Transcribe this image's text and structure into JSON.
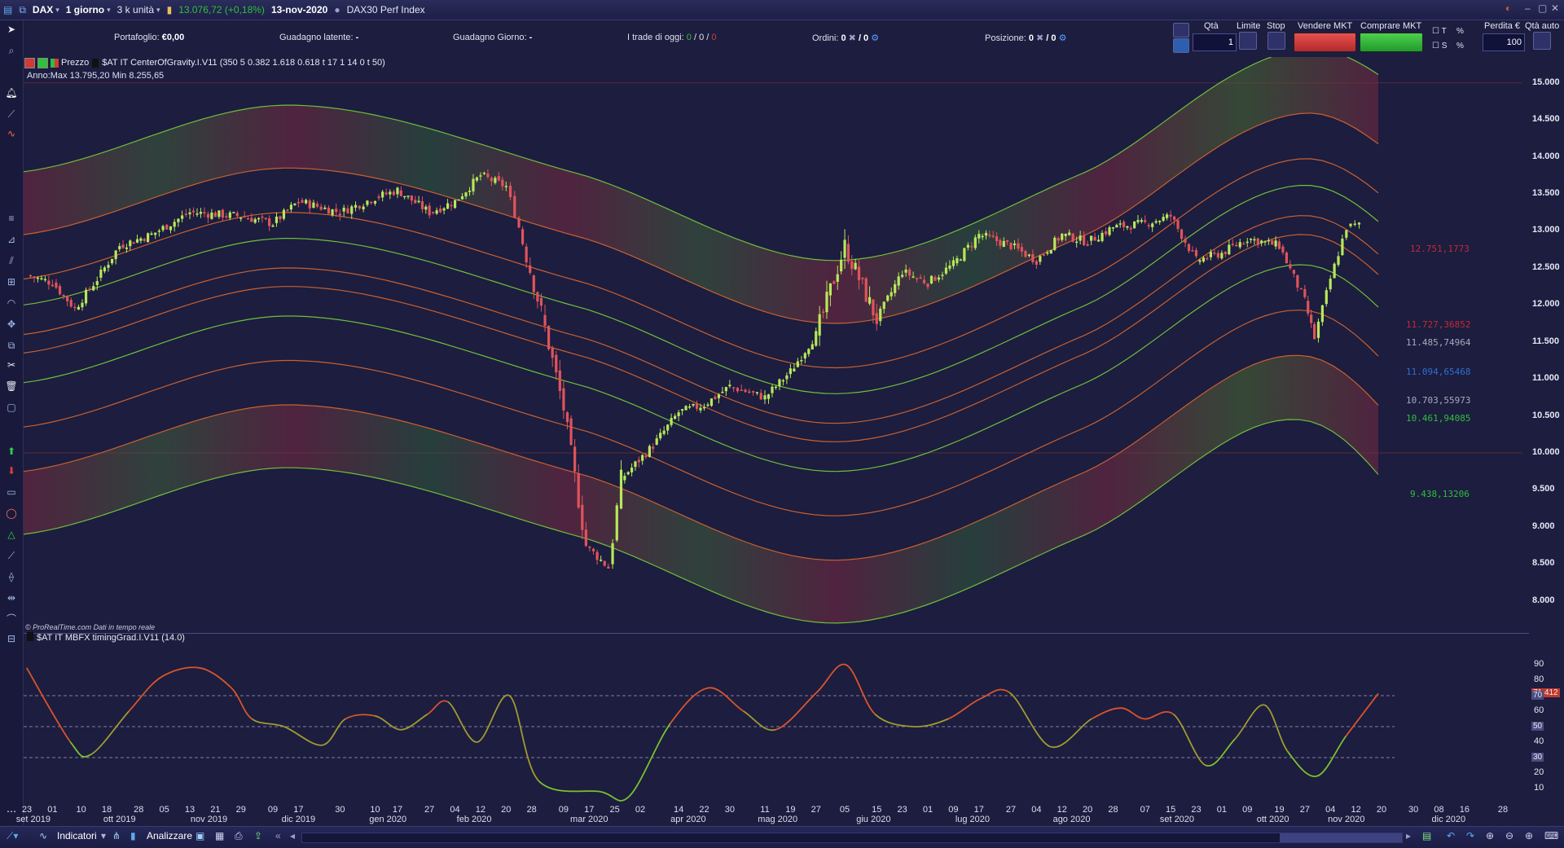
{
  "topbar": {
    "symbol": "DAX",
    "timeframe": "1 giorno",
    "units": "3 k unità",
    "last_price": "13.076,72 (+0,18%)",
    "date": "13-nov-2020",
    "instrument_name": "DAX30 Perf Index"
  },
  "portfolio": {
    "portafoglio_label": "Portafoglio:",
    "portafoglio_value": "€0,00",
    "guadagno_latente_label": "Guadagno latente:",
    "guadagno_latente_value": "-",
    "guadagno_giorno_label": "Guadagno Giorno:",
    "guadagno_giorno_value": "-",
    "trade_oggi_label": "I trade di oggi:",
    "trade_oggi_value1": "0",
    "trade_oggi_sep": "/ 0 /",
    "trade_oggi_value3": "0",
    "ordini_label": "Ordini:",
    "ordini_value": "0",
    "ordini_value2": "/ 0",
    "posizione_label": "Posizione:",
    "posizione_value": "0",
    "posizione_value2": "/ 0"
  },
  "order_panel": {
    "qta_label": "Qtà",
    "qta_value": "1",
    "limite_label": "Limite",
    "stop_label": "Stop",
    "vendere_label": "Vendere MKT",
    "comprare_label": "Comprare MKT",
    "t_label": "T",
    "s_label": "S",
    "pct_t": "%",
    "pct_s": "%",
    "perdita_label": "Perdita €",
    "perdita_value": "100",
    "qta_auto_label": "Qtà auto"
  },
  "legend": {
    "prezzo_label": "Prezzo",
    "indicator_label": "$AT IT CenterOfGravity.I.V11 (350 5 0.382 1.618 0.618 t 17 1 14 0 t 50)",
    "anno_text": "Anno:Max 13.795,20 Min 8.255,65",
    "osc_label": "$AT IT MBFX timingGrad.I.V11 (14.0)",
    "copyright": "© ProRealTime.com  Dati in tempo reale"
  },
  "price_scale": [
    "15.000",
    "14.500",
    "14.000",
    "13.500",
    "13.000",
    "12.500",
    "12.000",
    "11.500",
    "11.000",
    "10.500",
    "10.000",
    "9.500",
    "9.000",
    "8.500",
    "8.000"
  ],
  "osc_scale": [
    "90",
    "80",
    "70",
    "60",
    "50",
    "40",
    "30",
    "20",
    "10"
  ],
  "osc_markers": [
    "71,412",
    "70",
    "50",
    "30"
  ],
  "levels": [
    {
      "text": "12.751,1773",
      "color": "#c42a34"
    },
    {
      "text": "11.727,36852",
      "color": "#c42a34"
    },
    {
      "text": "11.485,74964",
      "color": "#a8aabb"
    },
    {
      "text": "11.094,65468",
      "color": "#2f6fd0"
    },
    {
      "text": "10.703,55973",
      "color": "#a8aabb"
    },
    {
      "text": "10.461,94085",
      "color": "#2fbf3a"
    },
    {
      "text": "9.438,13206",
      "color": "#2fbf3a"
    }
  ],
  "date_axis": {
    "days": [
      "23",
      "01",
      "10",
      "18",
      "28",
      "05",
      "13",
      "21",
      "29",
      "09",
      "17",
      "30",
      "10",
      "17",
      "27",
      "04",
      "12",
      "20",
      "28",
      "09",
      "17",
      "25",
      "02",
      "14",
      "22",
      "30",
      "11",
      "19",
      "27",
      "05",
      "15",
      "23",
      "01",
      "09",
      "17",
      "27",
      "04",
      "12",
      "20",
      "28",
      "07",
      "15",
      "23",
      "01",
      "09",
      "19",
      "27",
      "04",
      "12",
      "20",
      "30",
      "08",
      "16",
      "28"
    ],
    "months": [
      "set 2019",
      "ott 2019",
      "nov 2019",
      "dic 2019",
      "gen 2020",
      "feb 2020",
      "mar 2020",
      "apr 2020",
      "mag 2020",
      "giu 2020",
      "lug 2020",
      "ago 2020",
      "set 2020",
      "ott 2020",
      "nov 2020",
      "dic 2020"
    ]
  },
  "bottombar": {
    "indicatori_label": "Indicatori",
    "analizzare_label": "Analizzare"
  },
  "chart_data": {
    "type": "candlestick",
    "title": "DAX30 Perf Index",
    "timeframe": "1 giorno",
    "x_range": [
      "2019-09-23",
      "2020-12-28"
    ],
    "ylim": [
      7600,
      15350
    ],
    "close_series": [
      {
        "date": "2019-09-23",
        "value": 12400
      },
      {
        "date": "2019-10-01",
        "value": 12300
      },
      {
        "date": "2019-10-08",
        "value": 11950
      },
      {
        "date": "2019-10-15",
        "value": 12350
      },
      {
        "date": "2019-10-22",
        "value": 12800
      },
      {
        "date": "2019-11-01",
        "value": 12950
      },
      {
        "date": "2019-11-13",
        "value": 13250
      },
      {
        "date": "2019-11-29",
        "value": 13200
      },
      {
        "date": "2019-12-09",
        "value": 13100
      },
      {
        "date": "2019-12-17",
        "value": 13400
      },
      {
        "date": "2019-12-30",
        "value": 13250
      },
      {
        "date": "2020-01-10",
        "value": 13450
      },
      {
        "date": "2020-01-17",
        "value": 13550
      },
      {
        "date": "2020-01-27",
        "value": 13250
      },
      {
        "date": "2020-02-04",
        "value": 13400
      },
      {
        "date": "2020-02-12",
        "value": 13750
      },
      {
        "date": "2020-02-20",
        "value": 13600
      },
      {
        "date": "2020-02-24",
        "value": 13050
      },
      {
        "date": "2020-03-02",
        "value": 11900
      },
      {
        "date": "2020-03-09",
        "value": 10600
      },
      {
        "date": "2020-03-16",
        "value": 8750
      },
      {
        "date": "2020-03-23",
        "value": 8450
      },
      {
        "date": "2020-03-27",
        "value": 9650
      },
      {
        "date": "2020-04-06",
        "value": 10100
      },
      {
        "date": "2020-04-14",
        "value": 10550
      },
      {
        "date": "2020-04-22",
        "value": 10650
      },
      {
        "date": "2020-04-30",
        "value": 10900
      },
      {
        "date": "2020-05-11",
        "value": 10750
      },
      {
        "date": "2020-05-19",
        "value": 11100
      },
      {
        "date": "2020-05-27",
        "value": 11600
      },
      {
        "date": "2020-06-05",
        "value": 12800
      },
      {
        "date": "2020-06-15",
        "value": 11800
      },
      {
        "date": "2020-06-23",
        "value": 12450
      },
      {
        "date": "2020-07-01",
        "value": 12300
      },
      {
        "date": "2020-07-09",
        "value": 12550
      },
      {
        "date": "2020-07-17",
        "value": 12950
      },
      {
        "date": "2020-07-27",
        "value": 12800
      },
      {
        "date": "2020-08-04",
        "value": 12600
      },
      {
        "date": "2020-08-12",
        "value": 12950
      },
      {
        "date": "2020-08-20",
        "value": 12850
      },
      {
        "date": "2020-08-28",
        "value": 13050
      },
      {
        "date": "2020-09-07",
        "value": 13100
      },
      {
        "date": "2020-09-15",
        "value": 13200
      },
      {
        "date": "2020-09-23",
        "value": 12600
      },
      {
        "date": "2020-10-01",
        "value": 12700
      },
      {
        "date": "2020-10-09",
        "value": 12900
      },
      {
        "date": "2020-10-19",
        "value": 12800
      },
      {
        "date": "2020-10-27",
        "value": 12050
      },
      {
        "date": "2020-10-30",
        "value": 11550
      },
      {
        "date": "2020-11-04",
        "value": 12350
      },
      {
        "date": "2020-11-09",
        "value": 13050
      },
      {
        "date": "2020-11-13",
        "value": 13076.72
      }
    ],
    "annual_max": 13795.2,
    "annual_min": 8255.65,
    "levels": [
      12751.1773,
      11727.36852,
      11485.74964,
      11094.65468,
      10703.55973,
      10461.94085,
      9438.13206
    ],
    "oscillator": {
      "name": "$AT IT MBFX timingGrad.I.V11 (14.0)",
      "ylim": [
        0,
        100
      ],
      "reference_lines": [
        70,
        50,
        30
      ],
      "last_value": 71.412,
      "series": [
        {
          "date": "2019-09-23",
          "value": 88
        },
        {
          "date": "2019-10-08",
          "value": 40
        },
        {
          "date": "2019-10-15",
          "value": 32
        },
        {
          "date": "2019-10-28",
          "value": 60
        },
        {
          "date": "2019-11-08",
          "value": 82
        },
        {
          "date": "2019-11-21",
          "value": 88
        },
        {
          "date": "2019-12-02",
          "value": 75
        },
        {
          "date": "2019-12-09",
          "value": 55
        },
        {
          "date": "2019-12-20",
          "value": 50
        },
        {
          "date": "2020-01-02",
          "value": 38
        },
        {
          "date": "2020-01-10",
          "value": 55
        },
        {
          "date": "2020-01-20",
          "value": 57
        },
        {
          "date": "2020-01-29",
          "value": 48
        },
        {
          "date": "2020-02-07",
          "value": 58
        },
        {
          "date": "2020-02-14",
          "value": 66
        },
        {
          "date": "2020-02-24",
          "value": 40
        },
        {
          "date": "2020-03-06",
          "value": 70
        },
        {
          "date": "2020-03-16",
          "value": 15
        },
        {
          "date": "2020-04-06",
          "value": 8
        },
        {
          "date": "2020-04-16",
          "value": 5
        },
        {
          "date": "2020-04-30",
          "value": 52
        },
        {
          "date": "2020-05-13",
          "value": 75
        },
        {
          "date": "2020-05-25",
          "value": 60
        },
        {
          "date": "2020-06-05",
          "value": 48
        },
        {
          "date": "2020-06-19",
          "value": 72
        },
        {
          "date": "2020-06-29",
          "value": 90
        },
        {
          "date": "2020-07-09",
          "value": 58
        },
        {
          "date": "2020-07-22",
          "value": 50
        },
        {
          "date": "2020-08-03",
          "value": 55
        },
        {
          "date": "2020-08-14",
          "value": 68
        },
        {
          "date": "2020-08-24",
          "value": 72
        },
        {
          "date": "2020-09-07",
          "value": 37
        },
        {
          "date": "2020-09-21",
          "value": 55
        },
        {
          "date": "2020-10-01",
          "value": 62
        },
        {
          "date": "2020-10-09",
          "value": 55
        },
        {
          "date": "2020-10-19",
          "value": 58
        },
        {
          "date": "2020-10-30",
          "value": 25
        },
        {
          "date": "2020-11-09",
          "value": 42
        },
        {
          "date": "2020-11-19",
          "value": 64
        },
        {
          "date": "2020-11-27",
          "value": 34
        },
        {
          "date": "2020-12-07",
          "value": 18
        },
        {
          "date": "2020-12-17",
          "value": 44
        },
        {
          "date": "2020-12-28",
          "value": 71.412
        }
      ]
    }
  }
}
